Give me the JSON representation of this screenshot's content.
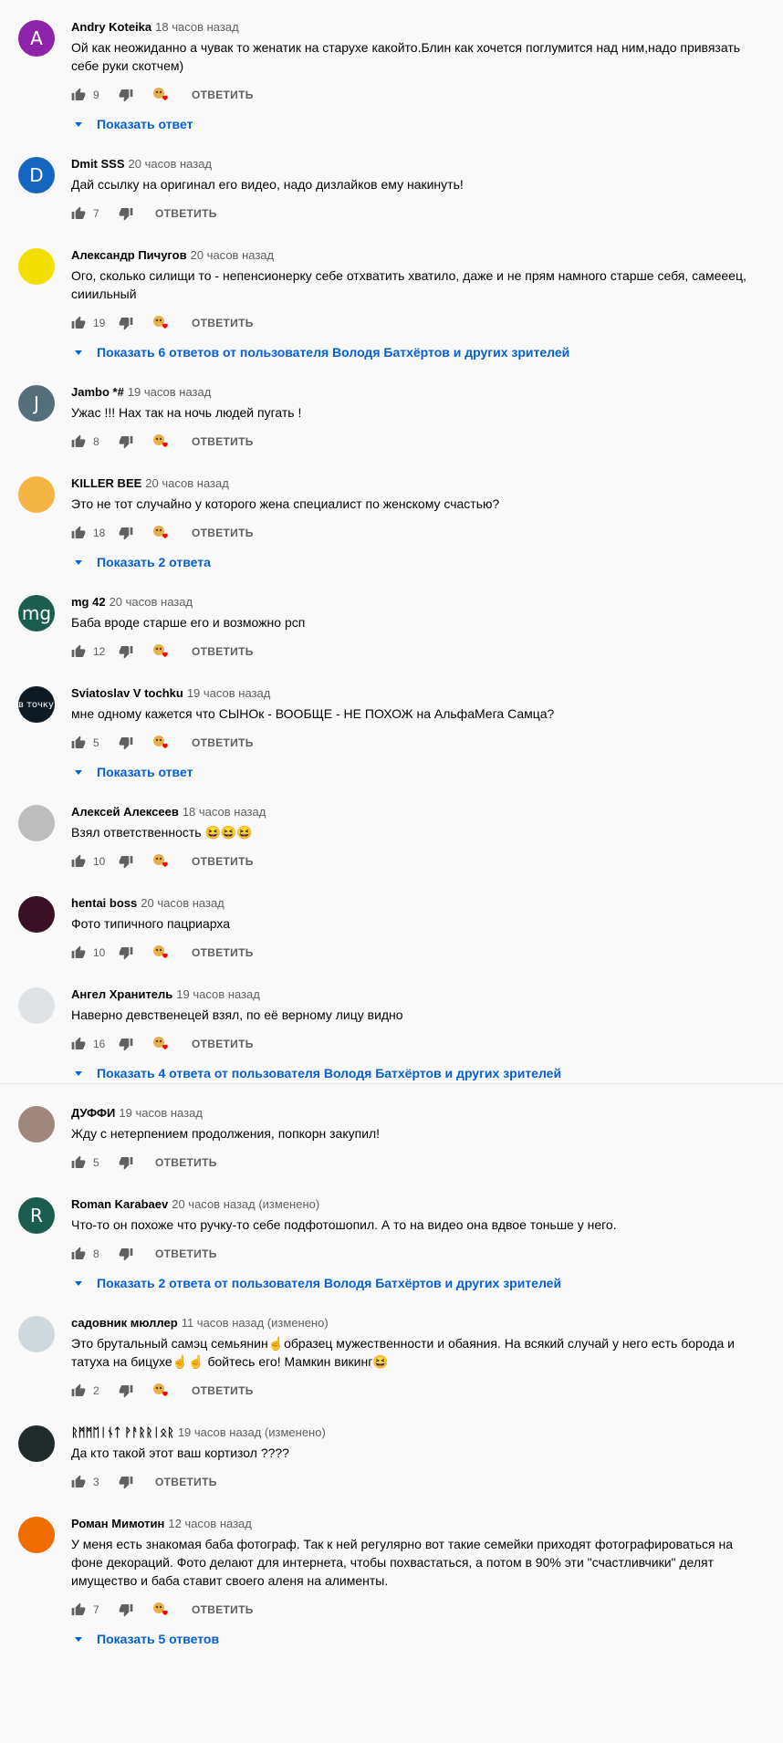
{
  "labels": {
    "reply": "ОТВЕТИТЬ"
  },
  "comments": [
    {
      "author": "Andry Koteika",
      "time": "18 часов назад",
      "text": "Ой как неожиданно а чувак то женатик на старухе какойто.Блин как хочется поглумится над ним,надо привязать себе руки скотчем)",
      "likes": "9",
      "heart": true,
      "replies": "Показать ответ",
      "avatar_letter": "A",
      "avatar_color": "#8e24aa"
    },
    {
      "author": "Dmit SSS",
      "time": "20 часов назад",
      "text": "Дай ссылку на оригинал его видео, надо дизлайков ему накинуть!",
      "likes": "7",
      "heart": false,
      "replies": "",
      "avatar_letter": "D",
      "avatar_color": "#1565c0"
    },
    {
      "author": "Александр Пичугов",
      "time": "20 часов назад",
      "text": "Ого, сколько силищи то - непенсионерку себе отхватить хватило, даже и не прям намного старше себя, самееец, сииильный",
      "likes": "19",
      "heart": true,
      "replies": "Показать 6 ответов от пользователя Володя Батхёртов и других зрителей",
      "avatar_letter": "",
      "avatar_color": "#f4e000"
    },
    {
      "author": "Jambo *#",
      "time": "19 часов назад",
      "text": "Ужас !!! Нах так на ночь людей пугать !",
      "likes": "8",
      "heart": true,
      "replies": "",
      "avatar_letter": "J",
      "avatar_color": "#546e7a"
    },
    {
      "author": "KILLER BEE",
      "time": "20 часов назад",
      "text": "Это не тот случайно у которого жена специалист по женскому счастью?",
      "likes": "18",
      "heart": true,
      "replies": "Показать 2 ответа",
      "avatar_letter": "",
      "avatar_color": "#f5b342"
    },
    {
      "author": "mg 42",
      "time": "20 часов назад",
      "text": "Баба вроде старше его и возможно рсп",
      "likes": "12",
      "heart": true,
      "replies": "",
      "avatar_letter": "mg",
      "avatar_color": "#1b5e4f"
    },
    {
      "author": "Sviatoslav V tochku",
      "time": "19 часов назад",
      "text": "мне одному кажется что СЫНОк - ВООБЩЕ - НЕ ПОХОЖ на АльфаМега Самца?",
      "likes": "5",
      "heart": true,
      "replies": "Показать ответ",
      "avatar_letter": "в точку",
      "avatar_color": "#0e1a24"
    },
    {
      "author": "Алексей Алексеев",
      "time": "18 часов назад",
      "text": "Взял ответственность 😆😆😆",
      "likes": "10",
      "heart": true,
      "replies": "",
      "avatar_letter": "",
      "avatar_color": "#bdbdbd"
    },
    {
      "author": "hentai boss",
      "time": "20 часов назад",
      "text": "Фото типичного пацриарха",
      "likes": "10",
      "heart": true,
      "replies": "",
      "avatar_letter": "",
      "avatar_color": "#3a1024"
    },
    {
      "author": "Ангел Хранитель",
      "time": "19 часов назад",
      "text": "Наверно девственецей взял, по её верному лицу видно",
      "likes": "16",
      "heart": true,
      "replies": "Показать 4 ответа от пользователя Володя Батхёртов и других зрителей",
      "avatar_letter": "",
      "avatar_color": "#dfe3e6"
    },
    {
      "author": "ДУФФИ",
      "time": "19 часов назад",
      "text": "Жду с нетерпением продолжения, попкорн закупил!",
      "likes": "5",
      "heart": false,
      "replies": "",
      "avatar_letter": "",
      "avatar_color": "#a1887f"
    },
    {
      "author": "Roman Karabaev",
      "time": "20 часов назад (изменено)",
      "text": "Что-то он похоже что ручку-то себе подфотошопил. А то на видео она вдвое тоньше у него.",
      "likes": "8",
      "heart": false,
      "replies": "Показать 2 ответа от пользователя Володя Батхёртов и других зрителей",
      "avatar_letter": "R",
      "avatar_color": "#1b5e4f"
    },
    {
      "author": "садовник мюллер",
      "time": "11 часов назад (изменено)",
      "text": "Это брутальный самэц семьянин☝️образец мужественности и обаяния. На всякий случай у него есть борода и татуха на бицухе☝️☝️ бойтесь его! Мамкин викинг😆",
      "likes": "2",
      "heart": true,
      "replies": "",
      "avatar_letter": "",
      "avatar_color": "#cfd8dc"
    },
    {
      "author": "ᚱᛗᛗᛖᛁᚾᛏ ᚹᚨᚱᚱᛁᛟᚱ",
      "time": "19 часов назад (изменено)",
      "text": "Да кто такой этот ваш кортизол ????",
      "likes": "3",
      "heart": false,
      "replies": "",
      "avatar_letter": "",
      "avatar_color": "#1f2a2a"
    },
    {
      "author": "Роман Мимотин",
      "time": "12 часов назад",
      "text": "У меня есть знакомая баба фотограф. Так к ней регулярно вот такие семейки приходят фотографироваться на фоне декораций. Фото делают для интернета, чтобы похвастаться, а потом в 90% эти \"счастливчики\"   делят имущество и баба ставит своего аленя на алименты.",
      "likes": "7",
      "heart": true,
      "replies": "Показать 5 ответов",
      "avatar_letter": "",
      "avatar_color": "#ef6c00"
    }
  ]
}
